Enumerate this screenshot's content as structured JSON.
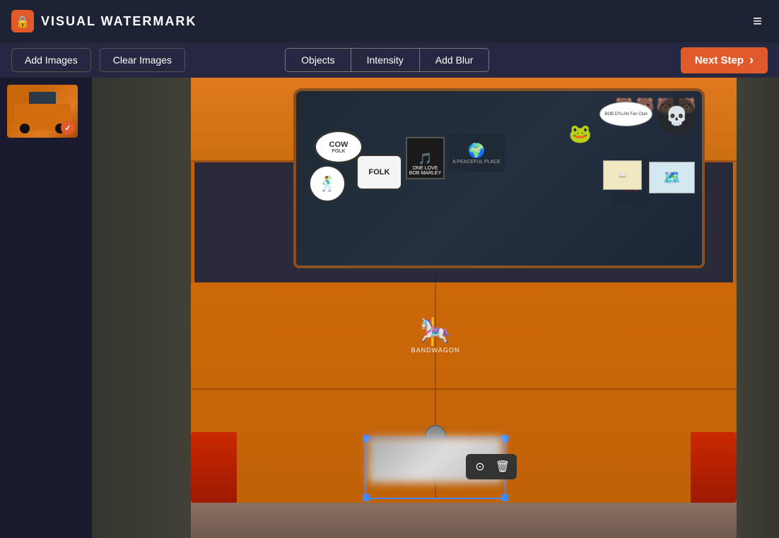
{
  "app": {
    "title": "VISUAL WATERMARK",
    "logo_icon": "🔒"
  },
  "header": {
    "hamburger_icon": "≡"
  },
  "toolbar": {
    "add_images_label": "Add Images",
    "clear_images_label": "Clear Images",
    "objects_label": "Objects",
    "intensity_label": "Intensity",
    "add_blur_label": "Add Blur",
    "next_step_label": "Next Step",
    "next_icon": "›"
  },
  "sidebar": {
    "thumbnail_alt": "Orange van thumbnail",
    "check_icon": "✓"
  },
  "canvas": {
    "plate_toolbar": {
      "restore_icon": "⊙",
      "delete_icon": "🗑"
    }
  },
  "colors": {
    "accent": "#e05a2b",
    "header_bg": "#1e2235",
    "toolbar_bg": "#252840",
    "sidebar_bg": "#1a1a2e",
    "selection": "#4488ff",
    "button_border": "#555"
  }
}
